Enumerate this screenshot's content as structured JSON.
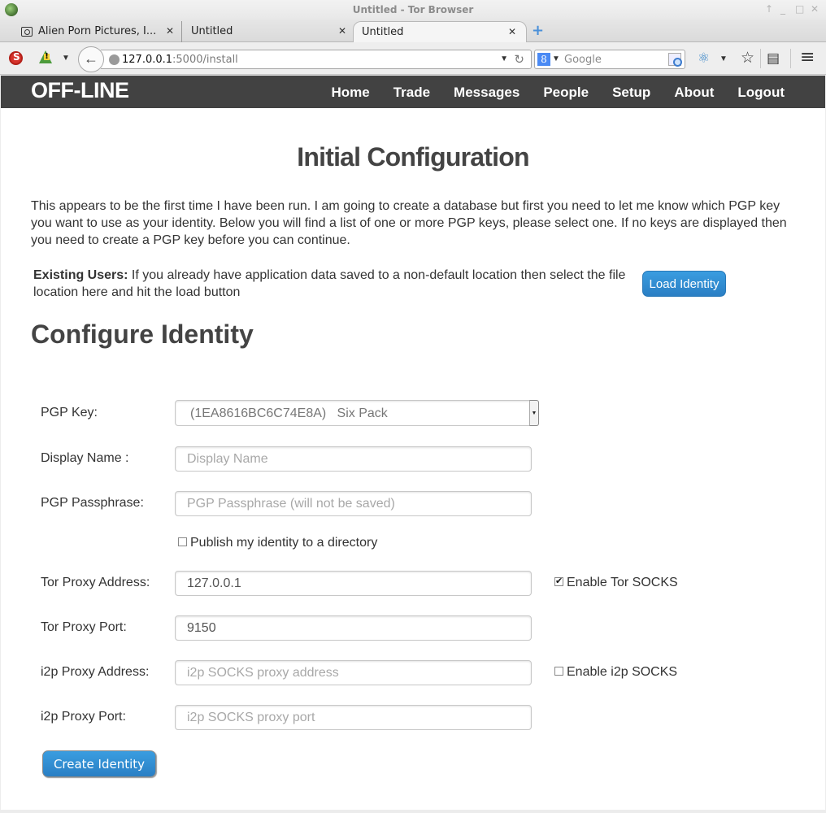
{
  "window": {
    "title": "Untitled - Tor Browser",
    "controls": [
      "↑",
      "_",
      "□",
      "✕"
    ]
  },
  "tabs": [
    {
      "label": "Alien Porn Pictures, I...",
      "icon": "photo-icon",
      "active": false
    },
    {
      "label": "Untitled",
      "active": false
    },
    {
      "label": "Untitled",
      "active": true
    }
  ],
  "toolbar": {
    "url_host": "127.0.0.1",
    "url_rest": ":5000/install",
    "search_placeholder": "Google",
    "search_engine_glyph": "8",
    "back_glyph": "←",
    "reload_glyph": "C",
    "newtab_glyph": "+",
    "menu_glyph": "≡",
    "bookmark_glyph": "☆",
    "reader_glyph": "▤",
    "caret_glyph": "▼"
  },
  "site": {
    "brand": "OFF-LINE",
    "nav": [
      "Home",
      "Trade",
      "Messages",
      "People",
      "Setup",
      "About",
      "Logout"
    ]
  },
  "main": {
    "title": "Initial Configuration",
    "intro": "This appears to be the first time I have been run. I am going to create a database but first you need to let me know which PGP key you want to use as your identity. Below you will find a list of one or more PGP keys, please select one. If no keys are displayed then you need to create a PGP key before you can continue.",
    "existing_bold": "Existing Users:",
    "existing_text": " If you already have application data saved to a non-default location then select the file location here and hit the load button",
    "load_button": "Load Identity",
    "section_title": "Configure Identity"
  },
  "form": {
    "pgp_key_label": "PGP Key:",
    "pgp_key_value": "(1EA8616BC6C74E8A)   Six Pack",
    "display_name_label": "Display Name :",
    "display_name_placeholder": "Display Name",
    "passphrase_label": "PGP Passphrase:",
    "passphrase_placeholder": "PGP Passphrase (will not be saved)",
    "publish_label": "Publish my identity to a directory",
    "publish_checked": false,
    "tor_address_label": "Tor Proxy Address:",
    "tor_address_value": "127.0.0.1",
    "tor_enable_label": "Enable Tor SOCKS",
    "tor_enable_checked": true,
    "tor_port_label": "Tor Proxy Port:",
    "tor_port_value": "9150",
    "i2p_address_label": "i2p Proxy Address:",
    "i2p_address_placeholder": "i2p SOCKS proxy address",
    "i2p_enable_label": "Enable i2p SOCKS",
    "i2p_enable_checked": false,
    "i2p_port_label": "i2p Proxy Port:",
    "i2p_port_placeholder": "i2p SOCKS proxy port",
    "create_button": "Create Identity"
  },
  "colors": {
    "nav_bg": "#424242",
    "button_blue": "#2a86cf",
    "heading": "#444444"
  }
}
